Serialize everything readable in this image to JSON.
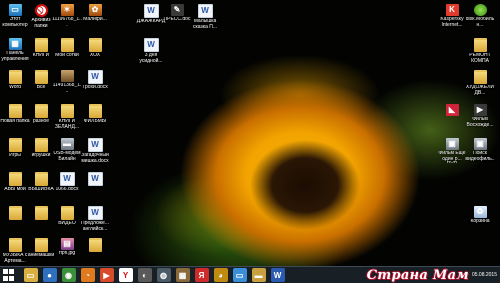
{
  "desktop": {
    "icons": [
      {
        "label": "Этот компьютер",
        "icon": "computer-icon",
        "kind": "pc",
        "glyph": "▭"
      },
      {
        "label": "Панель управления",
        "icon": "control-panel-icon",
        "kind": "pc",
        "glyph": "▦"
      },
      {
        "label": "Word",
        "icon": "folder-icon",
        "kind": "folder",
        "glyph": ""
      },
      {
        "label": "Новая папка",
        "icon": "folder-icon",
        "kind": "folder",
        "glyph": ""
      },
      {
        "label": "Игры",
        "icon": "folder-icon",
        "kind": "folder",
        "glyph": ""
      },
      {
        "label": "АВЫ мои",
        "icon": "folder-icon",
        "kind": "folder",
        "glyph": ""
      },
      {
        "label": "",
        "icon": "folder-icon",
        "kind": "folder",
        "glyph": ""
      },
      {
        "label": "МУЗЫКА с Артема...",
        "icon": "folder-icon",
        "kind": "folder",
        "glyph": ""
      },
      {
        "label": "Архивиз папки",
        "icon": "forbidden-icon",
        "kind": "forbid",
        "glyph": "⃠"
      },
      {
        "label": "КНИГИ",
        "icon": "folder-icon",
        "kind": "folder",
        "glyph": ""
      },
      {
        "label": "Все",
        "icon": "folder-icon",
        "kind": "folder",
        "glyph": ""
      },
      {
        "label": "разное",
        "icon": "folder-icon",
        "kind": "folder",
        "glyph": ""
      },
      {
        "label": "игрушки",
        "icon": "folder-icon",
        "kind": "folder",
        "glyph": ""
      },
      {
        "label": "ВЫШИВКА",
        "icon": "folder-icon",
        "kind": "folder",
        "glyph": ""
      },
      {
        "label": "",
        "icon": "folder-icon",
        "kind": "folder",
        "glyph": ""
      },
      {
        "label": "аниемашки",
        "icon": "folder-icon",
        "kind": "folder",
        "glyph": ""
      },
      {
        "label": "11196768_1...",
        "icon": "image-icon",
        "kind": "arch",
        "glyph": "✶"
      },
      {
        "label": "Мой сотки",
        "icon": "folder-icon",
        "kind": "folder",
        "glyph": ""
      },
      {
        "label": "11491368_1...",
        "icon": "image-icon",
        "kind": "img",
        "glyph": ""
      },
      {
        "label": "КНИГИ ЗЕЛАНД...",
        "icon": "folder-icon",
        "kind": "folder",
        "glyph": ""
      },
      {
        "label": "USB-модем Билайн",
        "icon": "usb-modem-icon",
        "kind": "dvr",
        "glyph": "▬"
      },
      {
        "label": "1066.docx",
        "icon": "document-icon",
        "kind": "doc",
        "glyph": "W"
      },
      {
        "label": "ВИДЕО",
        "icon": "folder-icon",
        "kind": "folder",
        "glyph": ""
      },
      {
        "label": "rfpfl.jpg",
        "icon": "image-icon",
        "kind": "zip",
        "glyph": "▤"
      },
      {
        "label": "Малифи...",
        "icon": "image-icon",
        "kind": "arch",
        "glyph": "✿"
      },
      {
        "label": "ХОХ",
        "icon": "folder-icon",
        "kind": "folder",
        "glyph": ""
      },
      {
        "label": "Трохи.docx",
        "icon": "document-icon",
        "kind": "doc",
        "glyph": "W"
      },
      {
        "label": "ФИЛЬМЫ",
        "icon": "folder-icon",
        "kind": "folder",
        "glyph": ""
      },
      {
        "label": "Загадочный мишка.docx",
        "icon": "document-icon",
        "kind": "doc",
        "glyph": "W"
      },
      {
        "label": "",
        "icon": "document-icon",
        "kind": "doc",
        "glyph": "W"
      },
      {
        "label": "Предложе... английск...",
        "icon": "document-icon",
        "kind": "doc",
        "glyph": "W"
      },
      {
        "label": "",
        "icon": "folder-icon",
        "kind": "folder",
        "glyph": ""
      },
      {
        "label": "ДЖАЖКАРД",
        "icon": "document-icon",
        "kind": "doc",
        "glyph": "W"
      },
      {
        "label": "3 дня усидной...",
        "icon": "document-icon",
        "kind": "doc",
        "glyph": "W"
      },
      {
        "label": "ПРЕСС.doc",
        "icon": "pen-icon",
        "kind": "dark",
        "glyph": "✎"
      },
      {
        "label": "Малышка сказка П...",
        "icon": "document-icon",
        "kind": "doc",
        "glyph": "W"
      },
      {
        "label": "Kaspersky Internet...",
        "icon": "kaspersky-icon",
        "kind": "k",
        "glyph": "K"
      },
      {
        "label": "disk.Мобильн...",
        "icon": "green-app-icon",
        "kind": "green",
        "glyph": ""
      },
      {
        "label": "РЕМОНТ КОМПА",
        "icon": "folder-icon",
        "kind": "folder",
        "glyph": ""
      },
      {
        "label": "ХУДОЖЕЛИ ДВ...",
        "icon": "folder-icon",
        "kind": "folder",
        "glyph": ""
      },
      {
        "label": "",
        "icon": "red-app-icon",
        "kind": "red",
        "glyph": "◣"
      },
      {
        "label": "Фильм Восхожде...",
        "icon": "video-icon",
        "kind": "dark",
        "glyph": "▶"
      },
      {
        "label": "Фильм Ещё один р... DVD",
        "icon": "video-icon",
        "kind": "dvr",
        "glyph": "▣"
      },
      {
        "label": "Поиск видеофиль...",
        "icon": "video-icon",
        "kind": "dvr",
        "glyph": "▣"
      },
      {
        "label": "Корзина",
        "icon": "recycle-bin-icon",
        "kind": "bin",
        "glyph": "♻"
      }
    ]
  },
  "taskbar": {
    "items": [
      {
        "name": "explorer-taskbar-icon",
        "glyph": "▭",
        "bg": "#d9b040"
      },
      {
        "name": "user-taskbar-icon",
        "glyph": "●",
        "bg": "#2f6fc0"
      },
      {
        "name": "chrome-taskbar-icon",
        "glyph": "◉",
        "bg": "#3a8f3a"
      },
      {
        "name": "firefox-taskbar-icon",
        "glyph": "◔",
        "bg": "#e07a1e"
      },
      {
        "name": "media-taskbar-icon",
        "glyph": "▶",
        "bg": "#d84a2a"
      },
      {
        "name": "yandex-taskbar-icon",
        "glyph": "Y",
        "bg": "#ffffff"
      },
      {
        "name": "app-taskbar-icon",
        "glyph": "◐",
        "bg": "#5a5a5a"
      },
      {
        "name": "network-taskbar-icon",
        "glyph": "◍",
        "bg": "#4a5a66"
      },
      {
        "name": "photos-taskbar-icon",
        "glyph": "▦",
        "bg": "#8a6a3a"
      },
      {
        "name": "yandex-browser-taskbar-icon",
        "glyph": "Я",
        "bg": "#d02b2b"
      },
      {
        "name": "aimp-taskbar-icon",
        "glyph": "◕",
        "bg": "#c08a10"
      },
      {
        "name": "screen-taskbar-icon",
        "glyph": "▭",
        "bg": "#3b8fd8"
      },
      {
        "name": "folder-taskbar-icon",
        "glyph": "▬",
        "bg": "#c9a040"
      },
      {
        "name": "word-taskbar-icon",
        "glyph": "W",
        "bg": "#2b5bb0"
      }
    ],
    "watermark": "Страна Мам",
    "clock": "05.08.2015"
  }
}
